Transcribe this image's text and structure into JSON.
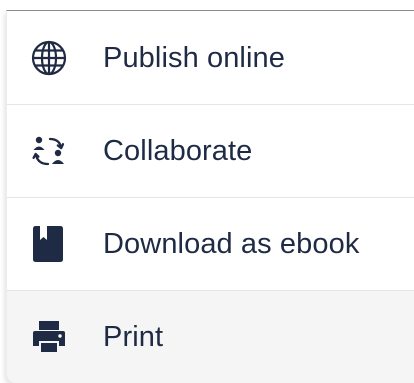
{
  "menu": {
    "items": [
      {
        "label": "Publish online",
        "icon": "globe-icon"
      },
      {
        "label": "Collaborate",
        "icon": "collaborate-icon"
      },
      {
        "label": "Download as ebook",
        "icon": "book-icon"
      },
      {
        "label": "Print",
        "icon": "printer-icon"
      }
    ]
  },
  "colors": {
    "text": "#1f2a44",
    "icon": "#1f2a44",
    "hover_background": "#f5f5f5",
    "divider": "#e6e6e6"
  }
}
